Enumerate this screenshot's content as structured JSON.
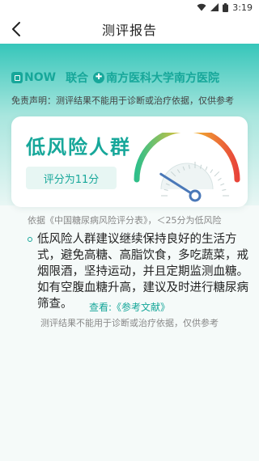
{
  "status_bar": {
    "time": "3:19"
  },
  "header": {
    "title": "测评报告",
    "back_icon": "chevron-left-icon"
  },
  "partners": {
    "brand": "NOW",
    "joiner": "联合",
    "hospital": "南方医科大学南方医院",
    "hospital_mark": "✚"
  },
  "disclaimer_top": "免责声明：测评结果不能用于诊断或治疗依据，仅供参考",
  "result": {
    "risk_level": "低风险人群",
    "score_label": "评分为11分",
    "gauge_level": 0.18
  },
  "criteria": "依据《中国糖尿病风险评分表》，＜25分为低风险",
  "advice": "低风险人群建议继续保持良好的生活方式，避免高糖、高脂饮食，多吃蔬菜，戒烟限酒，坚持运动，并且定期监测血糖。如有空腹血糖升高，建议及时进行糖尿病筛查。",
  "reference_link": "查看:《参考文献》",
  "disclaimer_bottom": "测评结果不能用于诊断或治疗依据，仅供参考",
  "colors": {
    "accent": "#17a79a",
    "gauge_low": "#2fbf8a",
    "gauge_mid": "#f2c230",
    "gauge_high": "#e8443a"
  }
}
